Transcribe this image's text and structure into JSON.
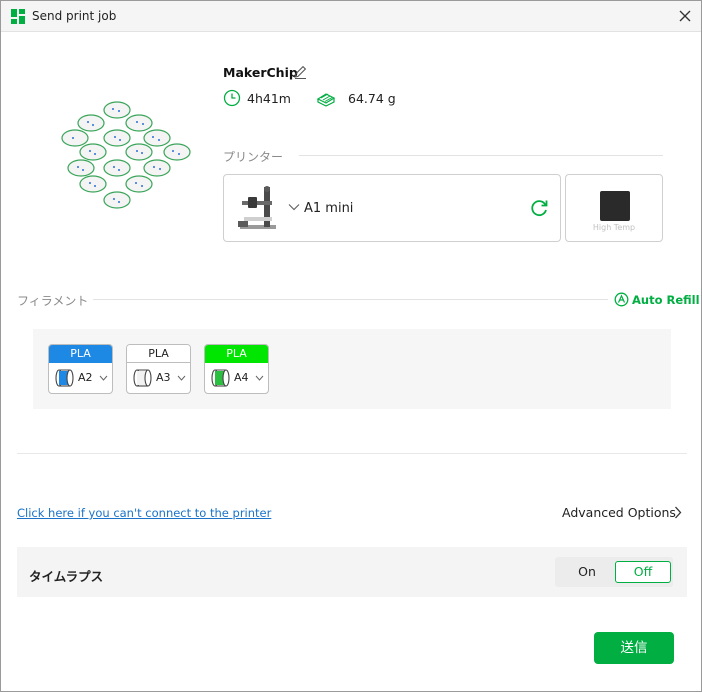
{
  "window": {
    "title": "Send print job"
  },
  "job": {
    "name": "MakerChip",
    "time": "4h41m",
    "weight": "64.74 g"
  },
  "printer": {
    "section_label": "プリンター",
    "name": "A1 mini",
    "plate_label": "High Temp"
  },
  "filament": {
    "section_label": "フィラメント",
    "auto_refill_label": "Auto Refill",
    "slots": [
      {
        "type": "PLA",
        "slot": "A2",
        "color": "#1e88e5",
        "text_color": "#ffffff"
      },
      {
        "type": "PLA",
        "slot": "A3",
        "color": "#ffffff",
        "text_color": "#222222"
      },
      {
        "type": "PLA",
        "slot": "A4",
        "color": "#00e600",
        "text_color": "#ffffff"
      }
    ]
  },
  "help": {
    "link_text": "Click here if you can't connect to the printer"
  },
  "advanced": {
    "label": "Advanced Options"
  },
  "timelapse": {
    "label": "タイムラプス",
    "on_label": "On",
    "off_label": "Off",
    "selected": "Off"
  },
  "actions": {
    "send_label": "送信"
  },
  "colors": {
    "accent": "#00ae42",
    "link": "#1a73c8"
  },
  "icons": {
    "app": "bambu-logo-icon",
    "close": "close-icon",
    "edit": "pencil-icon",
    "time": "clock-icon",
    "weight": "filament-weight-icon",
    "printer_dropdown": "chevron-down-icon",
    "refresh": "refresh-icon",
    "auto_refill": "auto-refill-icon",
    "advanced": "chevron-right-icon"
  }
}
